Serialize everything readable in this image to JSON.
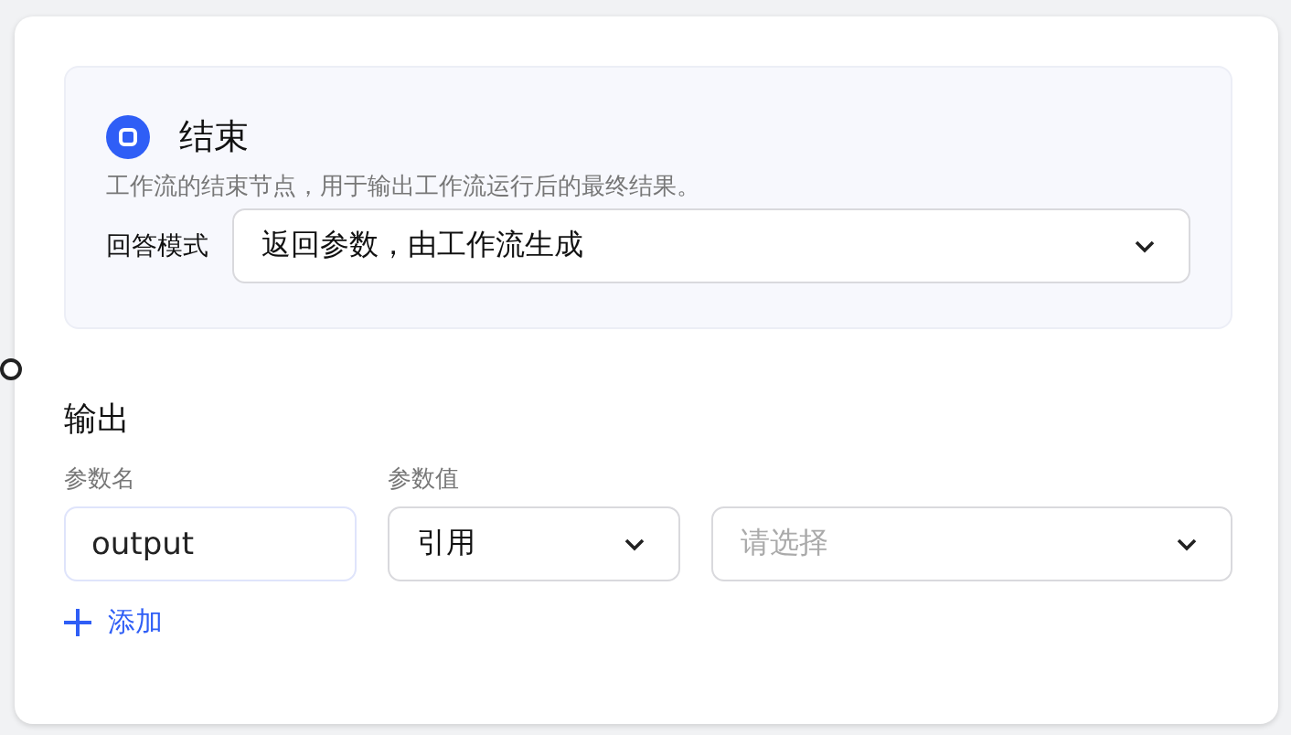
{
  "node": {
    "title": "结束",
    "description": "工作流的结束节点，用于输出工作流运行后的最终结果。",
    "answer_mode": {
      "label": "回答模式",
      "value": "返回参数，由工作流生成"
    }
  },
  "output": {
    "title": "输出",
    "columns": [
      "参数名",
      "参数值"
    ],
    "rows": [
      {
        "name": "output",
        "value_type": "引用",
        "reference_placeholder": "请选择"
      }
    ],
    "add_label": "添加"
  }
}
